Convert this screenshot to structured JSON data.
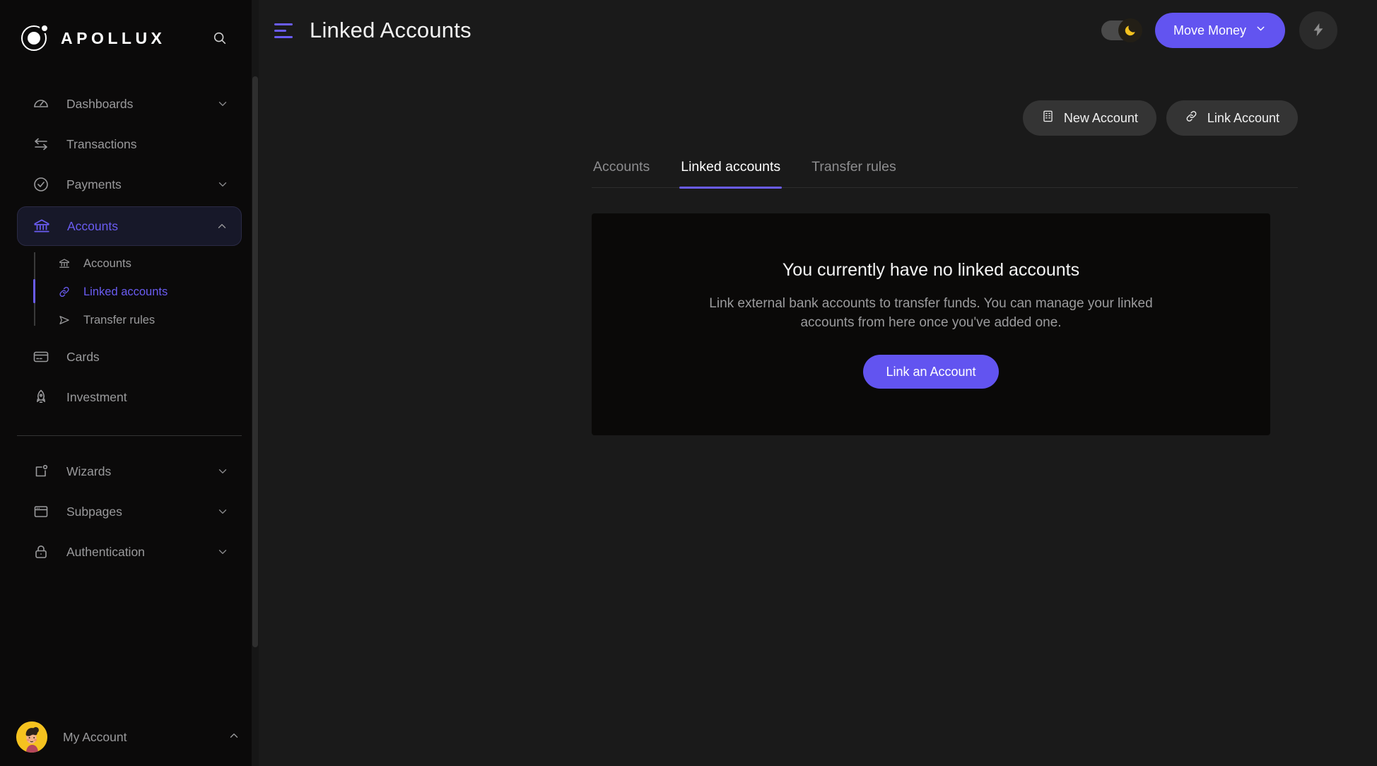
{
  "brand": {
    "name": "APOLLUX",
    "logo_icon": "orbit-logo-icon",
    "search_icon": "search-icon"
  },
  "sidebar": {
    "items": [
      {
        "label": "Dashboards",
        "icon": "gauge-icon",
        "chevron": "chevron-down-icon",
        "active": false
      },
      {
        "label": "Transactions",
        "icon": "transfer-arrows-icon",
        "chevron": "",
        "active": false
      },
      {
        "label": "Payments",
        "icon": "check-circle-icon",
        "chevron": "chevron-down-icon",
        "active": false
      },
      {
        "label": "Accounts",
        "icon": "bank-icon",
        "chevron": "chevron-up-icon",
        "active": true
      }
    ],
    "sub_items": [
      {
        "label": "Accounts",
        "icon": "bank-small-icon",
        "active": false
      },
      {
        "label": "Linked accounts",
        "icon": "link-icon",
        "active": true
      },
      {
        "label": "Transfer rules",
        "icon": "send-icon",
        "active": false
      }
    ],
    "items_after": [
      {
        "label": "Cards",
        "icon": "credit-card-icon",
        "chevron": "",
        "active": false
      },
      {
        "label": "Investment",
        "icon": "rocket-icon",
        "chevron": "",
        "active": false
      }
    ],
    "items_bottom": [
      {
        "label": "Wizards",
        "icon": "wizard-page-icon",
        "chevron": "chevron-down-icon",
        "active": false
      },
      {
        "label": "Subpages",
        "icon": "browser-window-icon",
        "chevron": "chevron-down-icon",
        "active": false
      },
      {
        "label": "Authentication",
        "icon": "lock-icon",
        "chevron": "chevron-down-icon",
        "active": false
      }
    ],
    "account": {
      "label": "My Account",
      "avatar_icon": "user-avatar",
      "chevron": "chevron-up-icon"
    }
  },
  "header": {
    "menu_icon": "hamburger-menu-icon",
    "title": "Linked Accounts",
    "theme_toggle": {
      "icon": "moon-icon",
      "state": "on"
    },
    "move_money_label": "Move Money",
    "move_money_chevron": "chevron-down-icon",
    "bolt_icon": "lightning-bolt-icon"
  },
  "actions": {
    "new_account_label": "New Account",
    "new_account_icon": "building-icon",
    "link_account_label": "Link Account",
    "link_account_icon": "link-icon"
  },
  "tabs": [
    {
      "label": "Accounts",
      "active": false
    },
    {
      "label": "Linked accounts",
      "active": true
    },
    {
      "label": "Transfer rules",
      "active": false
    }
  ],
  "empty_state": {
    "title": "You currently have no linked accounts",
    "description": "Link external bank accounts to transfer funds. You can manage your linked accounts from here once you've added one.",
    "cta_label": "Link an Account"
  },
  "colors": {
    "accent": "#6254f0",
    "accent_text": "#6a5cf2",
    "page_bg": "#1a1a1a",
    "sidebar_bg": "#0b0a0a",
    "card_bg": "#0a0908",
    "moon_yellow": "#f5c21f"
  }
}
